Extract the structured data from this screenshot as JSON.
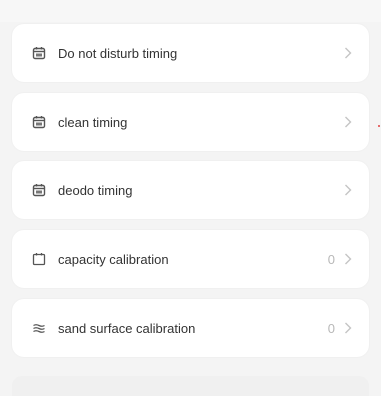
{
  "settings": {
    "items": [
      {
        "label": "Do not disturb timing",
        "icon": "calendar-icon",
        "value": ""
      },
      {
        "label": "clean timing",
        "icon": "calendar-icon",
        "value": ""
      },
      {
        "label": "deodo timing",
        "icon": "calendar-icon",
        "value": ""
      },
      {
        "label": "capacity calibration",
        "icon": "calendar-outline-icon",
        "value": "0"
      },
      {
        "label": "sand surface calibration",
        "icon": "sand-surface-icon",
        "value": "0"
      }
    ]
  },
  "colors": {
    "background": "#f4f4f4",
    "card": "#ffffff",
    "text": "#333333",
    "muted": "#b8b8b8"
  }
}
